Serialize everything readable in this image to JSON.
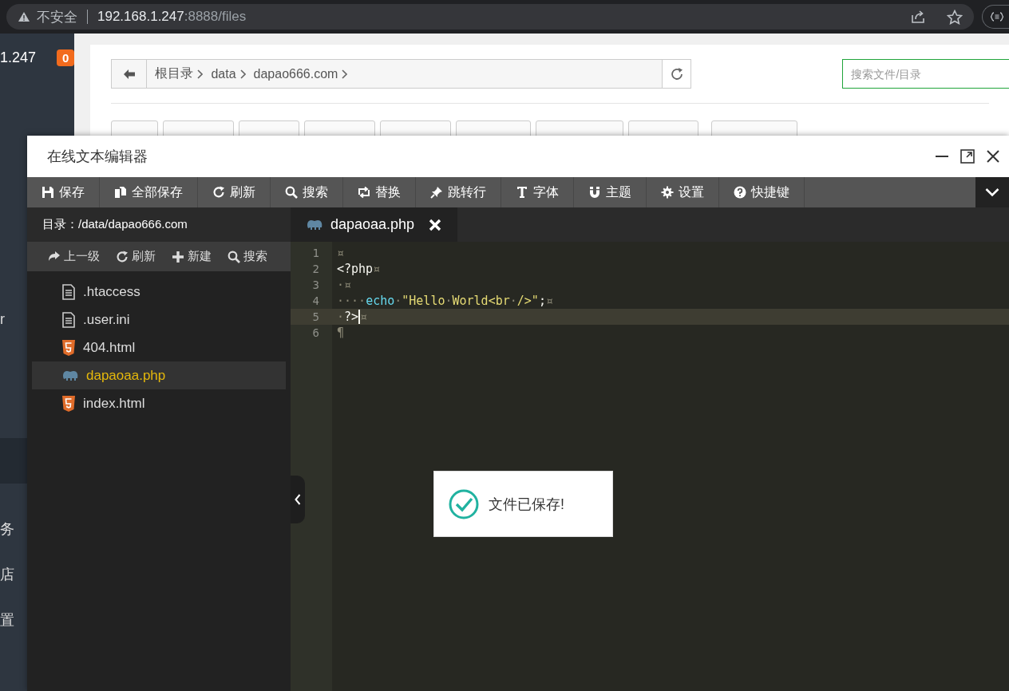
{
  "browser": {
    "security_label": "不安全",
    "url_host": "192.168.1.247",
    "url_rest": ":8888/files"
  },
  "sidebar": {
    "host_fragment": "1.247",
    "badge": "0",
    "items": [
      {
        "label": "r",
        "selected": false
      },
      {
        "selected": true
      },
      {
        "label": "务",
        "selected": false
      },
      {
        "label": "店",
        "selected": false
      },
      {
        "label": "置",
        "selected": false
      }
    ]
  },
  "breadcrumb": {
    "segments": [
      "根目录",
      "data",
      "dapao666.com"
    ]
  },
  "search": {
    "placeholder": "搜索文件/目录"
  },
  "editor": {
    "title": "在线文本编辑器",
    "toolbar": [
      {
        "label": "保存"
      },
      {
        "label": "全部保存"
      },
      {
        "label": "刷新"
      },
      {
        "label": "搜索"
      },
      {
        "label": "替换"
      },
      {
        "label": "跳转行"
      },
      {
        "label": "字体"
      },
      {
        "label": "主题"
      },
      {
        "label": "设置"
      },
      {
        "label": "快捷键"
      }
    ],
    "directory": "目录：/data/dapao666.com",
    "file_toolbar": [
      {
        "label": "上一级"
      },
      {
        "label": "刷新"
      },
      {
        "label": "新建"
      },
      {
        "label": "搜索"
      }
    ],
    "files": [
      {
        "name": ".htaccess",
        "kind": "text",
        "selected": false
      },
      {
        "name": ".user.ini",
        "kind": "text",
        "selected": false
      },
      {
        "name": "404.html",
        "kind": "html",
        "selected": false
      },
      {
        "name": "dapaoaa.php",
        "kind": "php",
        "selected": true
      },
      {
        "name": "index.html",
        "kind": "html",
        "selected": false
      }
    ],
    "tabs": [
      {
        "name": "dapaoaa.php",
        "selected": true
      }
    ],
    "lines": [
      {
        "number": "1",
        "current": false,
        "tokens": [
          {
            "kind": "marker",
            "text": "¤"
          }
        ]
      },
      {
        "number": "2",
        "current": false,
        "tokens": [
          {
            "kind": "plain",
            "text": "<?php"
          },
          {
            "kind": "marker",
            "text": "¤"
          }
        ]
      },
      {
        "number": "3",
        "current": false,
        "tokens": [
          {
            "kind": "marker",
            "text": "·¤"
          }
        ]
      },
      {
        "number": "4",
        "current": false,
        "tokens": [
          {
            "kind": "marker",
            "text": "····"
          },
          {
            "kind": "keyword",
            "text": "echo"
          },
          {
            "kind": "marker",
            "text": "·"
          },
          {
            "kind": "string",
            "text": "\"Hello"
          },
          {
            "kind": "marker",
            "text": "·"
          },
          {
            "kind": "string",
            "text": "World<br"
          },
          {
            "kind": "marker",
            "text": "·"
          },
          {
            "kind": "string",
            "text": "/>\""
          },
          {
            "kind": "plain",
            "text": ";"
          },
          {
            "kind": "marker",
            "text": "¤"
          }
        ]
      },
      {
        "number": "5",
        "current": true,
        "tokens": [
          {
            "kind": "marker",
            "text": "·"
          },
          {
            "kind": "plain",
            "text": "?>"
          },
          {
            "kind": "cursor"
          },
          {
            "kind": "marker",
            "text": "¤"
          }
        ]
      },
      {
        "number": "6",
        "current": false,
        "tokens": [
          {
            "kind": "marker",
            "text": "¶"
          }
        ]
      }
    ],
    "toast": {
      "message": "文件已保存!"
    }
  }
}
